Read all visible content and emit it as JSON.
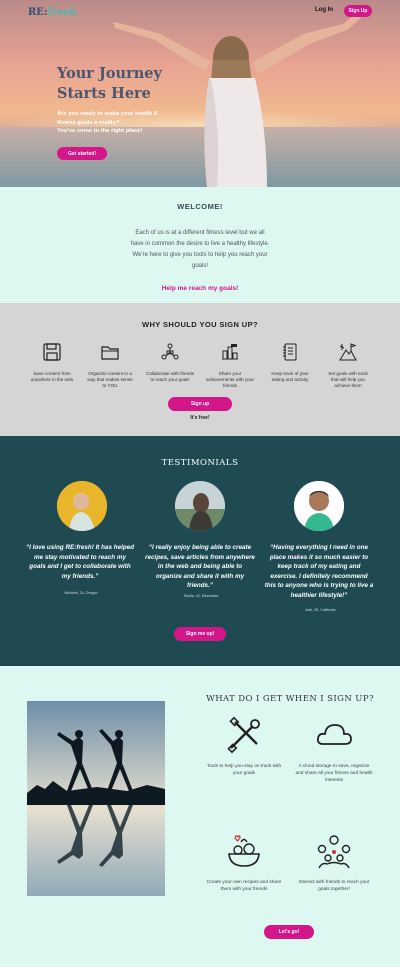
{
  "header": {
    "logo_prefix": "RE:",
    "logo_suffix": "fresh",
    "login_label": "Log In",
    "signup_label": "Sign Up"
  },
  "hero": {
    "title": "Your Journey Starts Here",
    "subtitle_line1": "Are you ready to make your health & fitness goals a reality?",
    "subtitle_line2": "You've come to the right place!",
    "button_label": "Get started!"
  },
  "welcome": {
    "title": "WELCOME!",
    "body": "Each of us is at a different fitness level but we all have in common the desire to live a healthy lifestyle. We're here to give you tools to help you reach your goals!",
    "cta": "Help me reach my goals!"
  },
  "why": {
    "title": "WHY SHOULD YOU SIGN UP?",
    "items": [
      {
        "icon": "save-icon",
        "label": "Save content from anywhere in the web"
      },
      {
        "icon": "folder-icon",
        "label": "Organize content in a way that makes sense to YOU"
      },
      {
        "icon": "people-network-icon",
        "label": "Collaborate with friends to reach your goals"
      },
      {
        "icon": "achievement-icon",
        "label": "Share your achievements with your friends"
      },
      {
        "icon": "notebook-icon",
        "label": "Keep track of your eating and activity"
      },
      {
        "icon": "goal-mountain-icon",
        "label": "Set goals with tools that will help you achieve them"
      }
    ],
    "button_label": "Sign up",
    "free_note": "It's free!"
  },
  "testimonials": {
    "title": "TESTIMONIALS",
    "items": [
      {
        "quote": "“I love using RE:fresh! It has helped me stay motivated to reach my goals and I get to collaborate with my friends.”",
        "author": "- Michelle, 24, Oregon"
      },
      {
        "quote": "“I really enjoy being able to create recipes, save articles from anywhere in the web and being able to organize and share it with my friends.”",
        "author": "- Sheila, 42, Minnesota"
      },
      {
        "quote": "“Having everything I need in one place makes it so much easier to keep track of my eating and exercise. I definitely recommend this to anyone who is trying to live a healthier lifestyle!”",
        "author": "- Josh, 26, California"
      }
    ],
    "button_label": "Sign me up!"
  },
  "get": {
    "title": "WHAT DO I GET WHEN I SIGN UP?",
    "features": [
      {
        "icon": "tools-icon",
        "label": "Tools to help you stay on track with your goals"
      },
      {
        "icon": "cloud-icon",
        "label": "A cloud storage to save, organize and share all your fitness and health interests"
      },
      {
        "icon": "salad-bowl-icon",
        "label": "Create your own recipes and share them with your friends"
      },
      {
        "icon": "group-icon",
        "label": "Interact with friends to reach your goals together!"
      }
    ],
    "button_label": "Let's go!"
  },
  "colors": {
    "accent": "#d4168b",
    "mint": "#dcf8f1",
    "teal_dark": "#1f4a52",
    "grey_section": "#d5d5d5"
  }
}
